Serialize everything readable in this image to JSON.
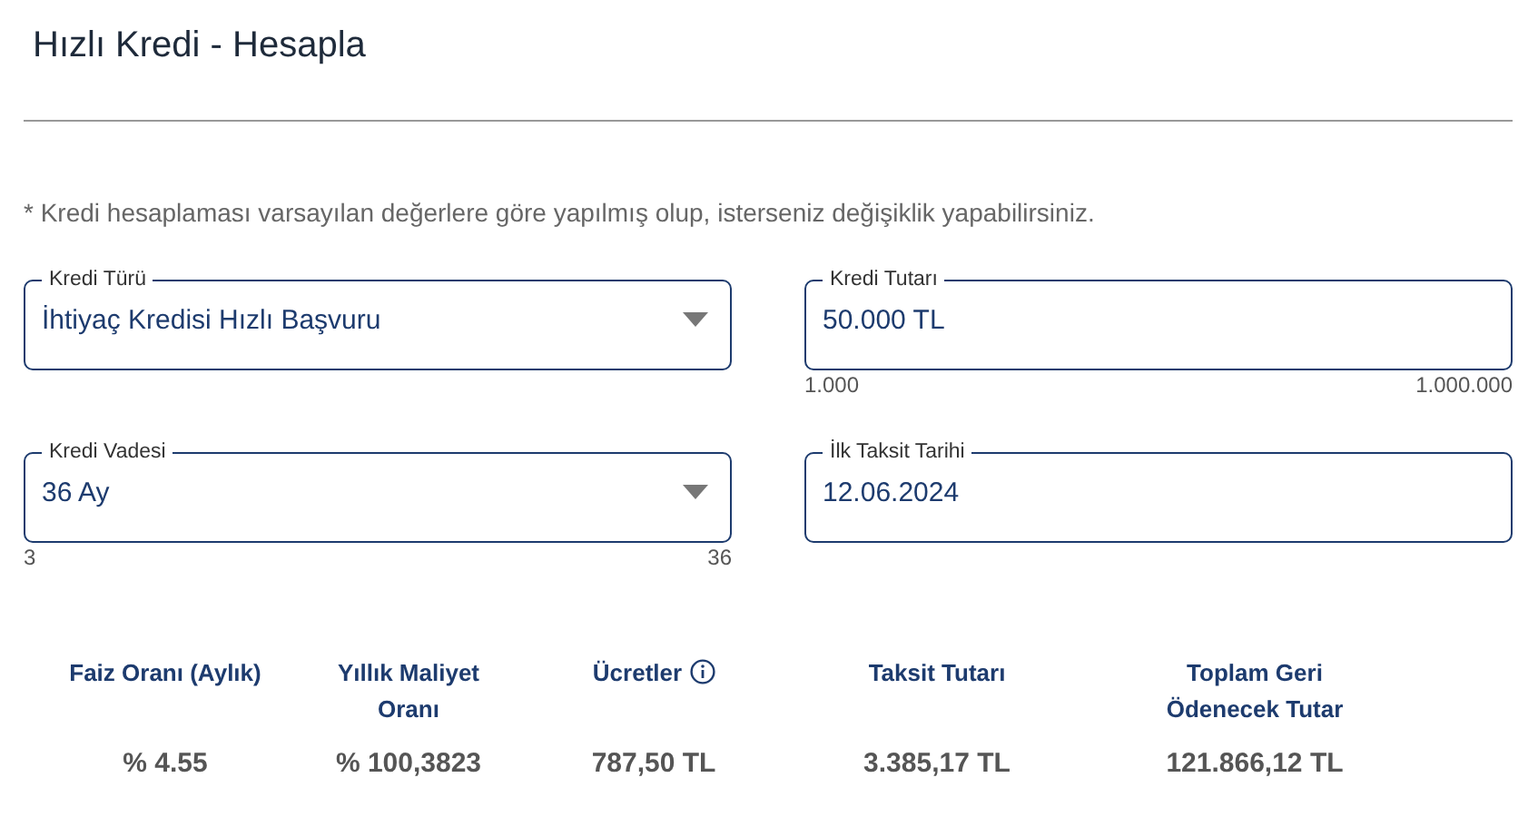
{
  "title": "Hızlı Kredi - Hesapla",
  "note": "* Kredi hesaplaması varsayılan değerlere göre yapılmış olup, isterseniz değişiklik yapabilirsiniz.",
  "fields": [
    {
      "kind": "select",
      "label": "Kredi Türü",
      "value": "İhtiyaç Kredisi Hızlı Başvuru"
    },
    {
      "kind": "input",
      "label": "Kredi Tutarı",
      "value": "50.000 TL",
      "min": "1.000",
      "max": "1.000.000"
    },
    {
      "kind": "select",
      "label": "Kredi Vadesi",
      "value": "36 Ay",
      "min": "3",
      "max": "36"
    },
    {
      "kind": "input",
      "label": "İlk Taksit Tarihi",
      "value": "12.06.2024"
    }
  ],
  "results": [
    {
      "label": "Faiz Oranı (Aylık)",
      "value": "% 4.55",
      "info": false
    },
    {
      "label": "Yıllık Maliyet Oranı",
      "value": "% 100,3823",
      "info": false
    },
    {
      "label": "Ücretler",
      "value": "787,50 TL",
      "info": true
    },
    {
      "label": "Taksit Tutarı",
      "value": "3.385,17 TL",
      "info": false
    },
    {
      "label": "Toplam Geri Ödenecek Tutar",
      "value": "121.866,12 TL",
      "info": false
    }
  ]
}
